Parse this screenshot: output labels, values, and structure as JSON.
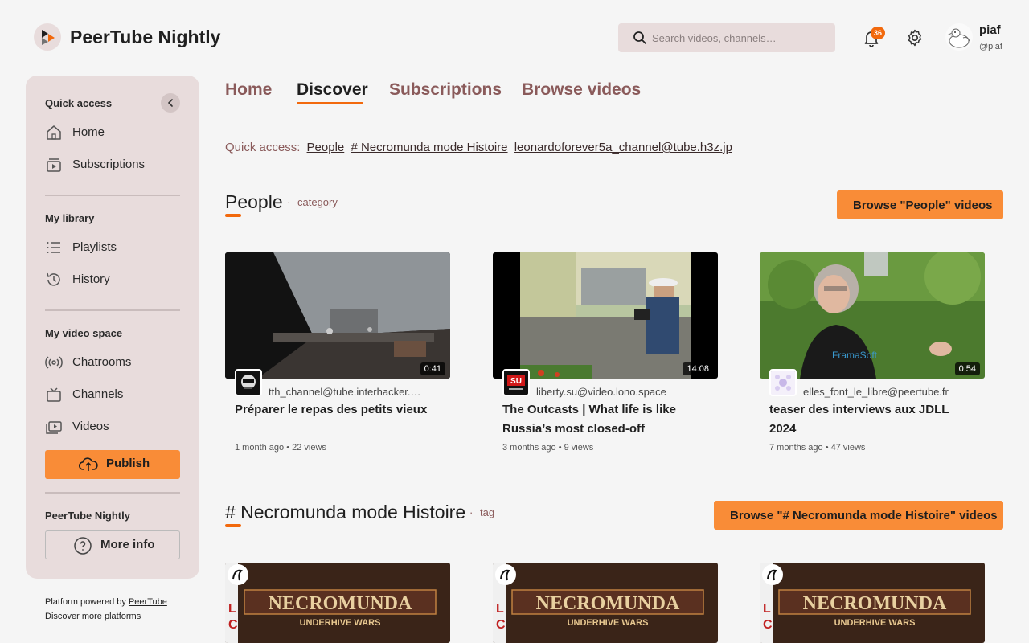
{
  "header": {
    "app_title": "PeerTube Nightly",
    "search_placeholder": "Search videos, channels…",
    "notification_count": "36",
    "user_name": "piaf",
    "user_handle": "@piaf",
    "icons": [
      "peertube-logo-icon",
      "search-icon",
      "bell-icon",
      "gear-icon"
    ]
  },
  "sidebar": {
    "quick_access_title": "Quick access",
    "quick_access_items": [
      {
        "label": "Home",
        "icon": "home-icon"
      },
      {
        "label": "Subscriptions",
        "icon": "subscriptions-icon"
      }
    ],
    "library_title": "My library",
    "library_items": [
      {
        "label": "Playlists",
        "icon": "playlists-icon"
      },
      {
        "label": "History",
        "icon": "history-icon"
      }
    ],
    "video_space_title": "My video space",
    "video_space_items": [
      {
        "label": "Chatrooms",
        "icon": "broadcast-icon"
      },
      {
        "label": "Channels",
        "icon": "tv-icon"
      },
      {
        "label": "Videos",
        "icon": "videos-icon"
      }
    ],
    "publish_label": "Publish",
    "instance_title": "PeerTube Nightly",
    "more_info_label": "More info"
  },
  "footer": {
    "powered_prefix": "Platform powered by",
    "powered_link": "PeerTube",
    "discover_link": "Discover more platforms"
  },
  "tabs": [
    "Home",
    "Discover",
    "Subscriptions",
    "Browse videos"
  ],
  "active_tab": "Discover",
  "quick_access": {
    "label": "Quick access:",
    "links": [
      "People",
      "# Necromunda mode Histoire",
      "leonardoforever5a_channel@tube.h3z.jp"
    ]
  },
  "sections": [
    {
      "title": "People",
      "kind": "category",
      "browse_label": "Browse \"People\" videos",
      "videos": [
        {
          "channel": "tth_channel@tube.interhacker.space",
          "title": "Préparer le repas des petits vieux",
          "meta": "1 month ago • 22 views",
          "duration": "0:41"
        },
        {
          "channel": "liberty.su@video.lono.space",
          "title": "The Outcasts | What life is like Russia’s most closed-off",
          "meta": "3 months ago • 9 views",
          "duration": "14:08"
        },
        {
          "channel": "elles_font_le_libre@peertube.fr",
          "title": "teaser des interviews aux JDLL 2024",
          "meta": "7 months ago • 47 views",
          "duration": "0:54"
        }
      ]
    },
    {
      "title": "# Necromunda mode Histoire",
      "kind": "tag",
      "browse_label": "Browse \"# Necromunda mode Histoire\" videos",
      "videos": [
        {
          "thumb_title": "NECROMUNDA",
          "thumb_subtitle": "UNDERHIVE WARS"
        },
        {
          "thumb_title": "NECROMUNDA",
          "thumb_subtitle": "UNDERHIVE WARS"
        },
        {
          "thumb_title": "NECROMUNDA",
          "thumb_subtitle": "UNDERHIVE WARS"
        }
      ]
    }
  ],
  "colors": {
    "accent": "#f98c37",
    "accent_dark": "#f2690d",
    "sidebar_bg": "#e8dcdc",
    "tab_inactive": "#8a5a5a"
  }
}
